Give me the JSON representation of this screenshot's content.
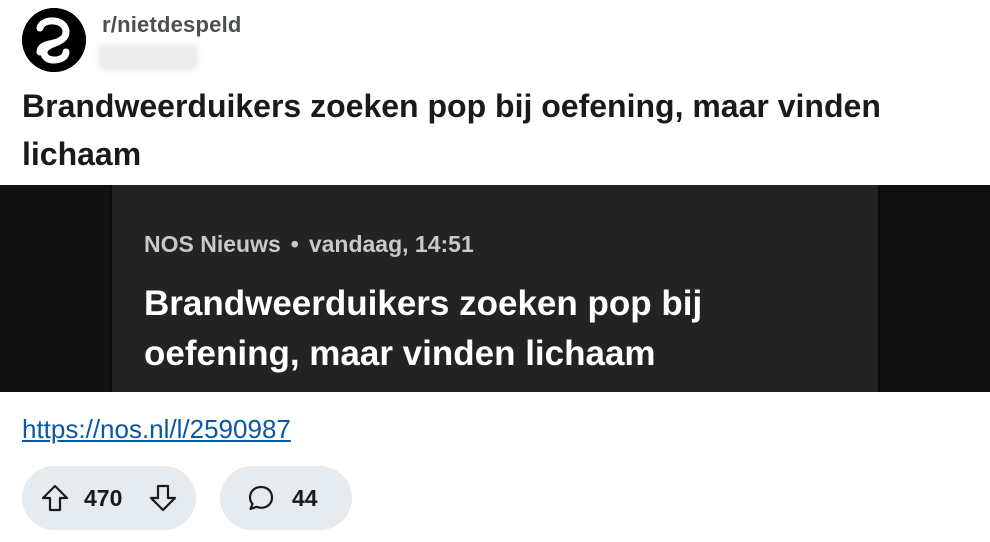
{
  "post": {
    "subreddit": "r/nietdespeld",
    "blurred_meta": "",
    "title": "Brandweerduikers zoeken pop bij oefening, maar vinden lichaam",
    "link": "https://nos.nl/l/2590987",
    "votes": "470",
    "comments": "44"
  },
  "media": {
    "source": "NOS Nieuws",
    "separator": "•",
    "time": "vandaag, 14:51",
    "headline": "Brandweerduikers zoeken pop bij oefening, maar vinden lichaam"
  },
  "icons": {
    "avatar": "subreddit-logo-icon",
    "upvote": "arrow-up-icon",
    "downvote": "arrow-down-icon",
    "comment": "speech-bubble-icon"
  },
  "colors": {
    "link": "#0b57a4",
    "pill_bg": "#e5ebee",
    "media_card_bg": "#232323"
  }
}
